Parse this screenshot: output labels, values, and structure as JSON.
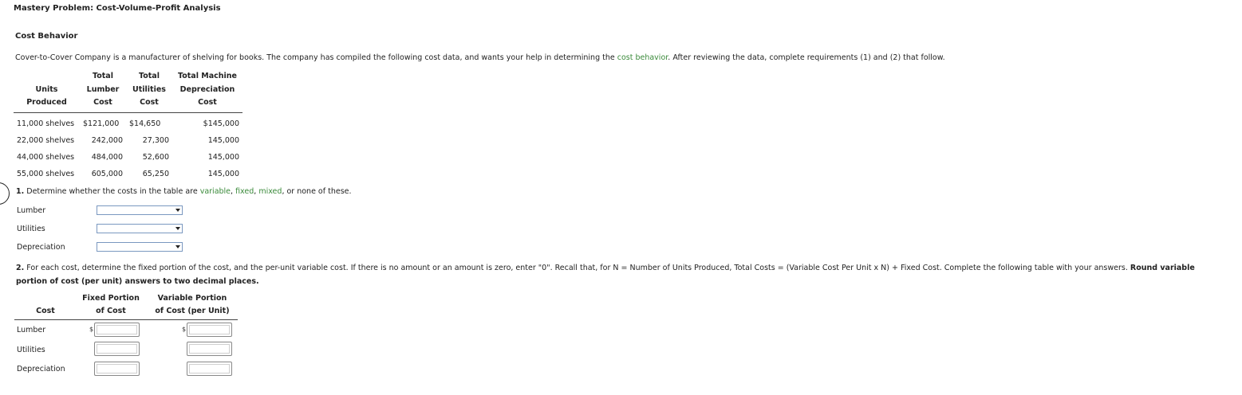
{
  "title": "Mastery Problem: Cost-Volume-Profit Analysis",
  "section_title": "Cost Behavior",
  "intro": {
    "before": "Cover-to-Cover Company is a manufacturer of shelving for books. The company has compiled the following cost data, and wants your help in determining the ",
    "link": "cost behavior",
    "after": ". After reviewing the data, complete requirements (1) and (2) that follow."
  },
  "cost_table": {
    "headers": {
      "units": [
        "Units",
        "Produced"
      ],
      "lumber": [
        "Total",
        "Lumber",
        "Cost"
      ],
      "utilities": [
        "Total",
        "Utilities",
        "Cost"
      ],
      "depreciation": [
        "Total Machine",
        "Depreciation",
        "Cost"
      ]
    },
    "rows": [
      {
        "units": "11,000 shelves",
        "lumber": "$121,000",
        "utilities": "$14,650",
        "depreciation": "$145,000"
      },
      {
        "units": "22,000 shelves",
        "lumber": "242,000",
        "utilities": "27,300",
        "depreciation": "145,000"
      },
      {
        "units": "44,000 shelves",
        "lumber": "484,000",
        "utilities": "52,600",
        "depreciation": "145,000"
      },
      {
        "units": "55,000 shelves",
        "lumber": "605,000",
        "utilities": "65,250",
        "depreciation": "145,000"
      }
    ]
  },
  "q1": {
    "prefix": "1.",
    "text": " Determine whether the costs in the table are ",
    "variable": "variable",
    "sep1": ", ",
    "fixed": "fixed",
    "sep2": ", ",
    "mixed": "mixed",
    "end": ", or none of these.",
    "items": [
      {
        "label": "Lumber",
        "value": ""
      },
      {
        "label": "Utilities",
        "value": ""
      },
      {
        "label": "Depreciation",
        "value": ""
      }
    ]
  },
  "q2": {
    "prefix": "2.",
    "text": " For each cost, determine the fixed portion of the cost, and the per-unit variable cost. If there is no amount or an amount is zero, enter \"0\". Recall that, for N = Number of Units Produced, Total Costs = (Variable Cost Per Unit x N) + Fixed Cost. Complete the following table with your answers. ",
    "bold": "Round variable portion of cost (per unit) answers to two decimal places."
  },
  "answer_table": {
    "headers": {
      "cost": "Cost",
      "fixed": [
        "Fixed Portion",
        "of Cost"
      ],
      "variable": [
        "Variable Portion",
        "of Cost (per Unit)"
      ]
    },
    "currency": "$",
    "rows": [
      {
        "label": "Lumber",
        "fixed": "",
        "variable": ""
      },
      {
        "label": "Utilities",
        "fixed": "",
        "variable": ""
      },
      {
        "label": "Depreciation",
        "fixed": "",
        "variable": ""
      }
    ]
  }
}
